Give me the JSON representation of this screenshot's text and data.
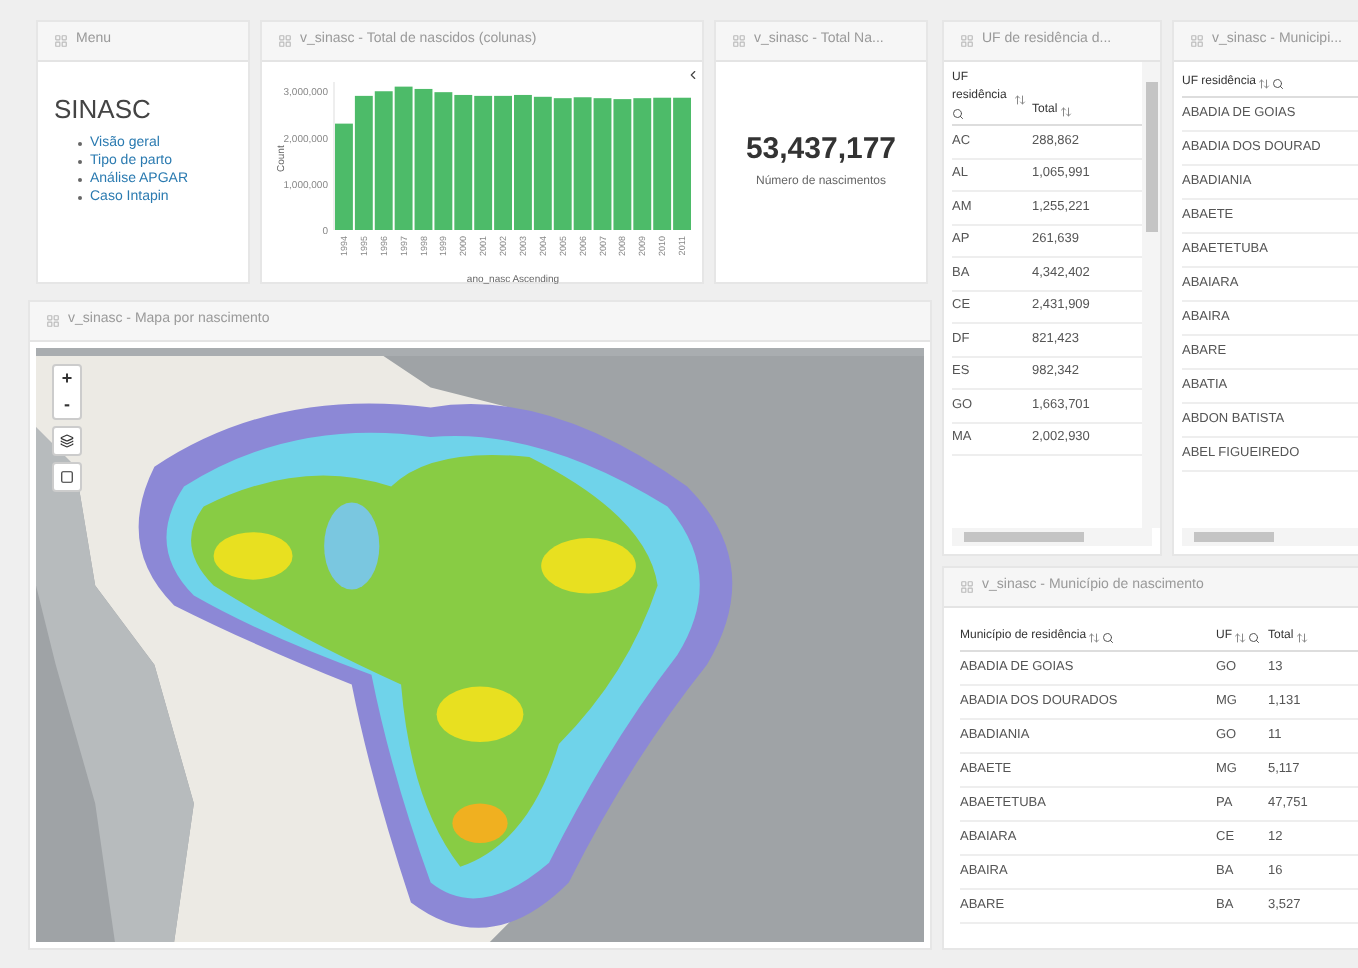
{
  "menu": {
    "title": "Menu",
    "heading": "SINASC",
    "links": [
      "Visão geral",
      "Tipo de parto",
      "Análise APGAR",
      "Caso Intapin"
    ]
  },
  "bar_panel": {
    "title": "v_sinasc - Total de nascidos (colunas)",
    "chart_data": {
      "type": "bar",
      "xlabel": "ano_nasc Ascending",
      "ylabel": "Count",
      "categories": [
        "1994",
        "1995",
        "1996",
        "1997",
        "1998",
        "1999",
        "2000",
        "2001",
        "2002",
        "2003",
        "2004",
        "2005",
        "2006",
        "2007",
        "2008",
        "2009",
        "2010",
        "2011"
      ],
      "series": [
        {
          "color": "#4dbb69",
          "values": [
            2300000,
            2900000,
            3000000,
            3100000,
            3050000,
            2980000,
            2920000,
            2900000,
            2900000,
            2920000,
            2880000,
            2850000,
            2870000,
            2850000,
            2830000,
            2850000,
            2860000,
            2860000
          ]
        }
      ],
      "ylim": [
        0,
        3200000
      ],
      "yticks": [
        {
          "value": 0,
          "label": "0"
        },
        {
          "value": 1000000,
          "label": "1,000,000"
        },
        {
          "value": 2000000,
          "label": "2,000,000"
        },
        {
          "value": 3000000,
          "label": "3,000,000"
        }
      ]
    }
  },
  "total_panel": {
    "title": "v_sinasc - Total Na...",
    "value": "53,437,177",
    "caption": "Número de nascimentos"
  },
  "uf_table": {
    "title": "UF de residência d...",
    "columns": [
      "UF residência",
      "Total"
    ],
    "rows": [
      [
        "AC",
        "288,862"
      ],
      [
        "AL",
        "1,065,991"
      ],
      [
        "AM",
        "1,255,221"
      ],
      [
        "AP",
        "261,639"
      ],
      [
        "BA",
        "4,342,402"
      ],
      [
        "CE",
        "2,431,909"
      ],
      [
        "DF",
        "821,423"
      ],
      [
        "ES",
        "982,342"
      ],
      [
        "GO",
        "1,663,701"
      ],
      [
        "MA",
        "2,002,930"
      ]
    ]
  },
  "municipio_list": {
    "title": "v_sinasc - Municipi...",
    "column": "UF residência",
    "rows": [
      "ABADIA DE GOIAS",
      "ABADIA DOS DOURAD",
      "ABADIANIA",
      "ABAETE",
      "ABAETETUBA",
      "ABAIARA",
      "ABAIRA",
      "ABARE",
      "ABATIA",
      "ABDON BATISTA",
      "ABEL FIGUEIREDO"
    ]
  },
  "map_panel": {
    "title": "v_sinasc - Mapa por nascimento",
    "controls": [
      "+",
      "-"
    ]
  },
  "municipio_table": {
    "title": "v_sinasc - Município de nascimento",
    "columns": [
      "Município de residência",
      "UF",
      "Total"
    ],
    "rows": [
      [
        "ABADIA DE GOIAS",
        "GO",
        "13"
      ],
      [
        "ABADIA DOS DOURADOS",
        "MG",
        "1,131"
      ],
      [
        "ABADIANIA",
        "GO",
        "11"
      ],
      [
        "ABAETE",
        "MG",
        "5,117"
      ],
      [
        "ABAETETUBA",
        "PA",
        "47,751"
      ],
      [
        "ABAIARA",
        "CE",
        "12"
      ],
      [
        "ABAIRA",
        "BA",
        "16"
      ],
      [
        "ABARE",
        "BA",
        "3,527"
      ]
    ]
  }
}
